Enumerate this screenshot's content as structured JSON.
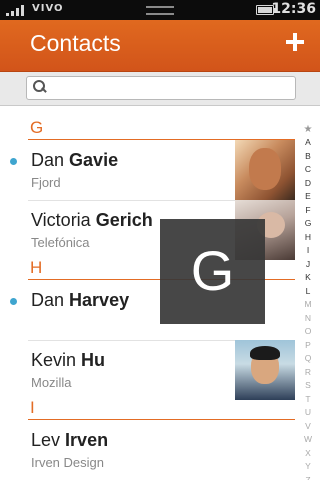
{
  "status_bar": {
    "carrier": "VIVO",
    "time": "12:36",
    "battery_level": 1.0,
    "signal_icon": "signal-bars-icon",
    "battery_icon": "battery-icon"
  },
  "header": {
    "title": "Contacts",
    "add_icon": "plus-icon"
  },
  "search": {
    "icon": "search-icon",
    "placeholder": "",
    "value": ""
  },
  "sections": [
    {
      "letter": "G",
      "contacts": [
        {
          "first": "Dan",
          "last": "Gavie",
          "org": "Fjord",
          "favorite": true,
          "photo": true
        },
        {
          "first": "Victoria",
          "last": "Gerich",
          "org": "Telefónica",
          "favorite": false,
          "photo": true
        }
      ]
    },
    {
      "letter": "H",
      "contacts": [
        {
          "first": "Dan",
          "last": "Harvey",
          "org": "",
          "favorite": true,
          "photo": false
        },
        {
          "first": "Kevin",
          "last": "Hu",
          "org": "Mozilla",
          "favorite": false,
          "photo": true
        }
      ]
    },
    {
      "letter": "I",
      "contacts": [
        {
          "first": "Lev",
          "last": "Irven",
          "org": "Irven Design",
          "favorite": false,
          "photo": false
        }
      ]
    }
  ],
  "index": {
    "star": "★",
    "letters": [
      "A",
      "B",
      "C",
      "D",
      "E",
      "F",
      "G",
      "H",
      "I",
      "J",
      "K",
      "L",
      "M",
      "N",
      "O",
      "P",
      "Q",
      "R",
      "S",
      "T",
      "U",
      "V",
      "W",
      "X",
      "Y",
      "Z"
    ],
    "dim_letters": [
      "M",
      "N",
      "O",
      "P",
      "Q",
      "R",
      "S",
      "T",
      "U",
      "V",
      "W",
      "X",
      "Y",
      "Z"
    ]
  },
  "overlay": {
    "letter": "G"
  },
  "colors": {
    "accent": "#e36c25",
    "favorite_dot": "#3fa5cf",
    "header_bg": "#d95e1c"
  }
}
